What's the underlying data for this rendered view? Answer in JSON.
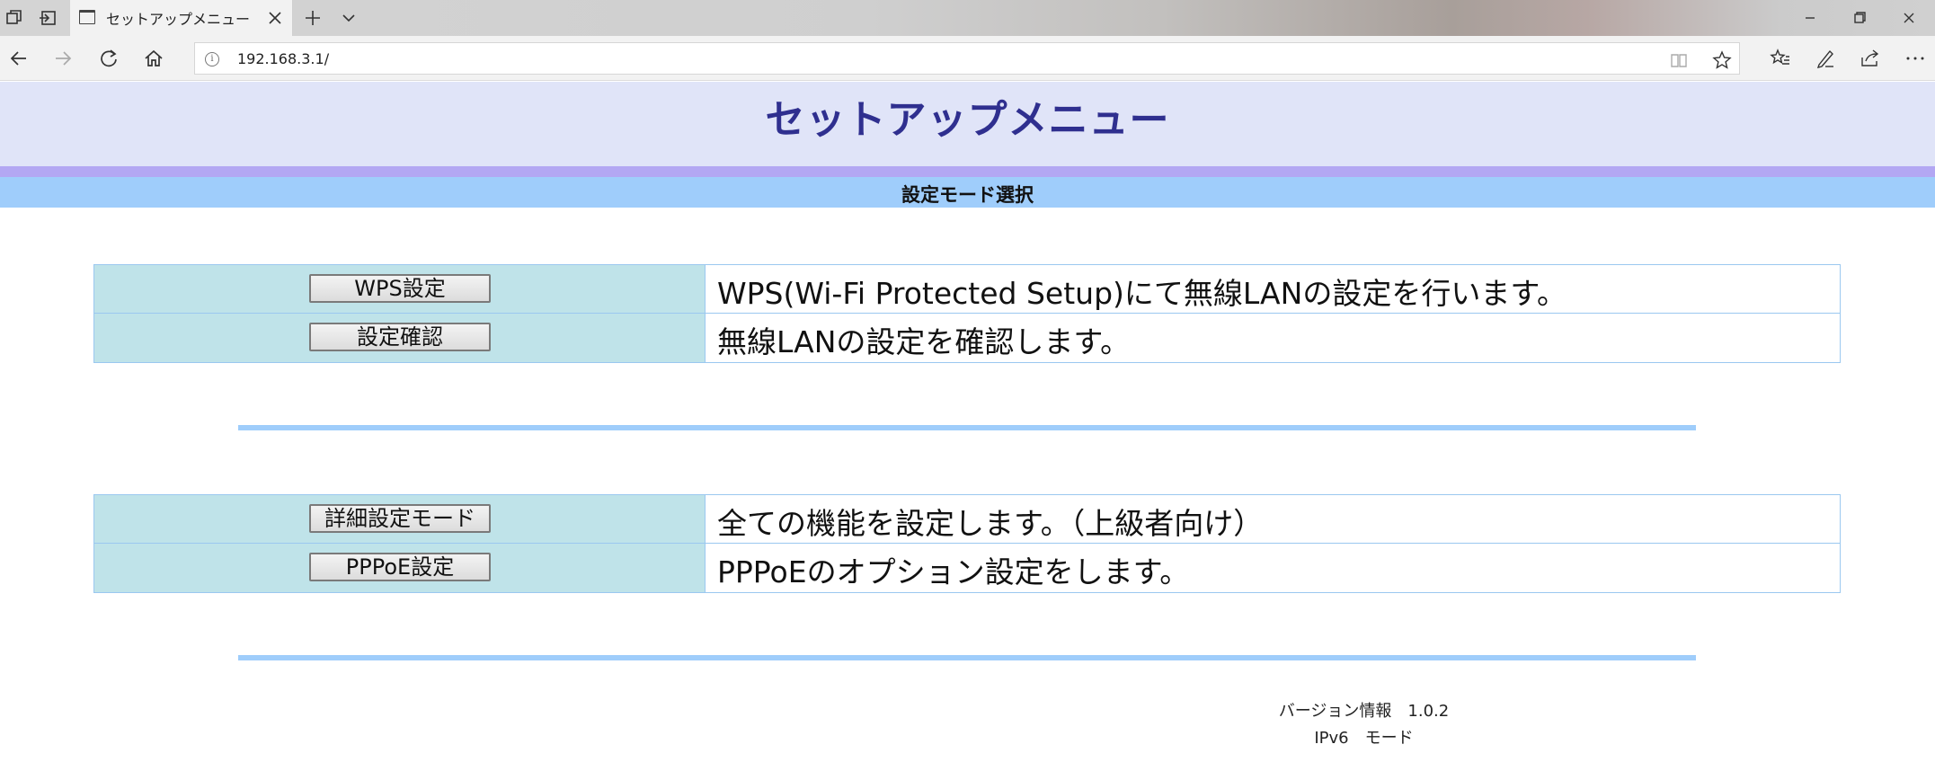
{
  "browser": {
    "tab_title": "セットアップメニュー",
    "url": "192.168.3.1/"
  },
  "page": {
    "title": "セットアップメニュー",
    "section_label": "設定モード選択",
    "group1": [
      {
        "button": "WPS設定",
        "description": "WPS(Wi-Fi Protected Setup)にて無線LANの設定を行います。"
      },
      {
        "button": "設定確認",
        "description": "無線LANの設定を確認します。"
      }
    ],
    "group2": [
      {
        "button": "詳細設定モード",
        "description": "全ての機能を設定します。（上級者向け）"
      },
      {
        "button": "PPPoE設定",
        "description": "PPPoEのオプション設定をします。"
      }
    ],
    "version_line": "バージョン情報　1.0.2",
    "mode_line": "IPv6　モード"
  },
  "colors": {
    "header_bg": "#e0e4f8",
    "title_text": "#2f2f8f",
    "stripe_purple": "#b3a7f3",
    "stripe_blue": "#9fcdfb",
    "cell_teal": "#bfe3e9"
  }
}
